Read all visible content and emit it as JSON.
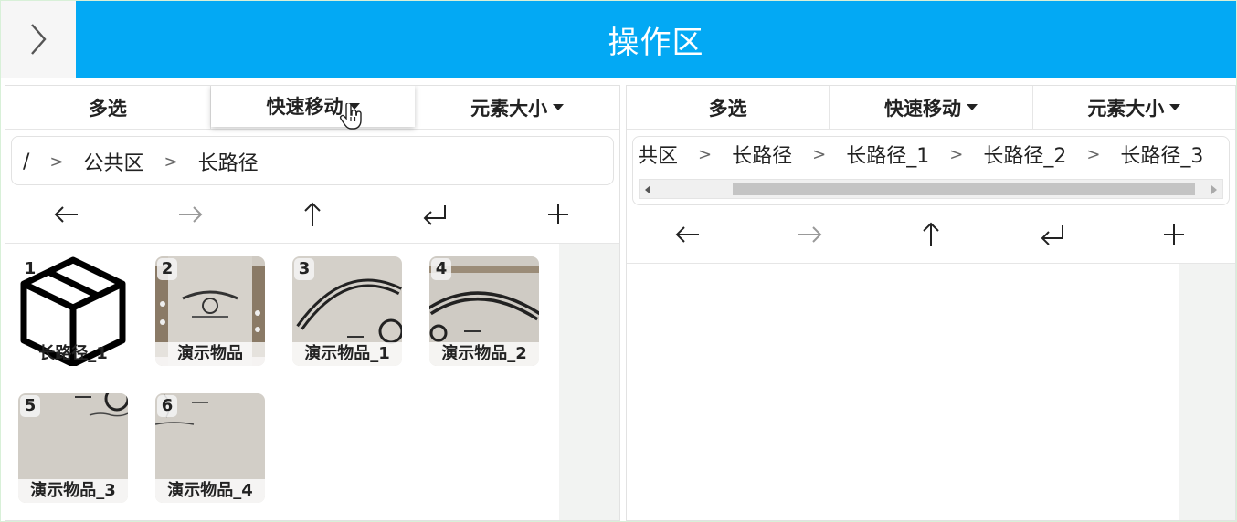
{
  "header": {
    "back_icon": "chevron-right-icon",
    "title": "操作区",
    "title_bg": "#03a9f4"
  },
  "left_panel": {
    "toolbar": {
      "multi_select": "多选",
      "quick_move": "快速移动",
      "element_size": "元素大小"
    },
    "breadcrumb": {
      "root": "/",
      "items": [
        "公共区",
        "长路径"
      ],
      "separator": ">"
    },
    "nav": {
      "back_icon": "arrow-left-icon",
      "forward_icon": "arrow-right-icon",
      "up_icon": "arrow-up-icon",
      "enter_icon": "return-icon",
      "add_icon": "plus-icon"
    },
    "items": [
      {
        "index": "1",
        "name": "长路径_1",
        "type": "folder"
      },
      {
        "index": "2",
        "name": "演示物品",
        "type": "image"
      },
      {
        "index": "3",
        "name": "演示物品_1",
        "type": "image"
      },
      {
        "index": "4",
        "name": "演示物品_2",
        "type": "image"
      },
      {
        "index": "5",
        "name": "演示物品_3",
        "type": "image"
      },
      {
        "index": "6",
        "name": "演示物品_4",
        "type": "image"
      }
    ]
  },
  "right_panel": {
    "toolbar": {
      "multi_select": "多选",
      "quick_move": "快速移动",
      "element_size": "元素大小"
    },
    "breadcrumb": {
      "items": [
        "共区",
        "长路径",
        "长路径_1",
        "长路径_2",
        "长路径_3"
      ],
      "separator": ">"
    },
    "nav": {
      "back_icon": "arrow-left-icon",
      "forward_icon": "arrow-right-icon",
      "up_icon": "arrow-up-icon",
      "enter_icon": "return-icon",
      "add_icon": "plus-icon"
    }
  }
}
